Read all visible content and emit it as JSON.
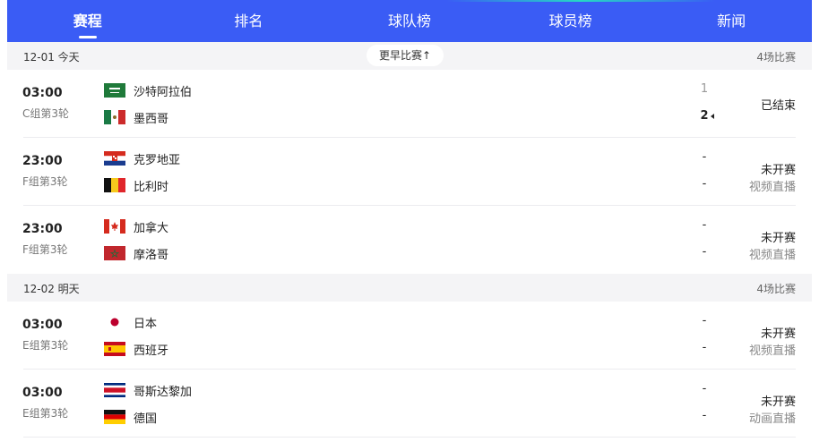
{
  "nav": {
    "tabs": [
      {
        "label": "赛程"
      },
      {
        "label": "排名"
      },
      {
        "label": "球队榜"
      },
      {
        "label": "球员榜"
      },
      {
        "label": "新闻"
      }
    ]
  },
  "days": [
    {
      "date": "12-01 今天",
      "earlier_label": "更早比赛↑",
      "count": "4场比赛",
      "matches": [
        {
          "time": "03:00",
          "group": "C组第3轮",
          "team1": "沙特阿拉伯",
          "team2": "墨西哥",
          "score1": "1",
          "score2": "2",
          "status": "已结束",
          "sub": ""
        },
        {
          "time": "23:00",
          "group": "F组第3轮",
          "team1": "克罗地亚",
          "team2": "比利时",
          "score1": "-",
          "score2": "-",
          "status": "未开赛",
          "sub": "视频直播"
        },
        {
          "time": "23:00",
          "group": "F组第3轮",
          "team1": "加拿大",
          "team2": "摩洛哥",
          "score1": "-",
          "score2": "-",
          "status": "未开赛",
          "sub": "视频直播"
        }
      ]
    },
    {
      "date": "12-02 明天",
      "count": "4场比赛",
      "matches": [
        {
          "time": "03:00",
          "group": "E组第3轮",
          "team1": "日本",
          "team2": "西班牙",
          "score1": "-",
          "score2": "-",
          "status": "未开赛",
          "sub": "视频直播"
        },
        {
          "time": "03:00",
          "group": "E组第3轮",
          "team1": "哥斯达黎加",
          "team2": "德国",
          "score1": "-",
          "score2": "-",
          "status": "未开赛",
          "sub": "动画直播"
        }
      ]
    }
  ],
  "colors": {
    "nav_bg": "#3a5cf5",
    "day_header_bg": "#f4f4f6",
    "muted": "#888888"
  }
}
